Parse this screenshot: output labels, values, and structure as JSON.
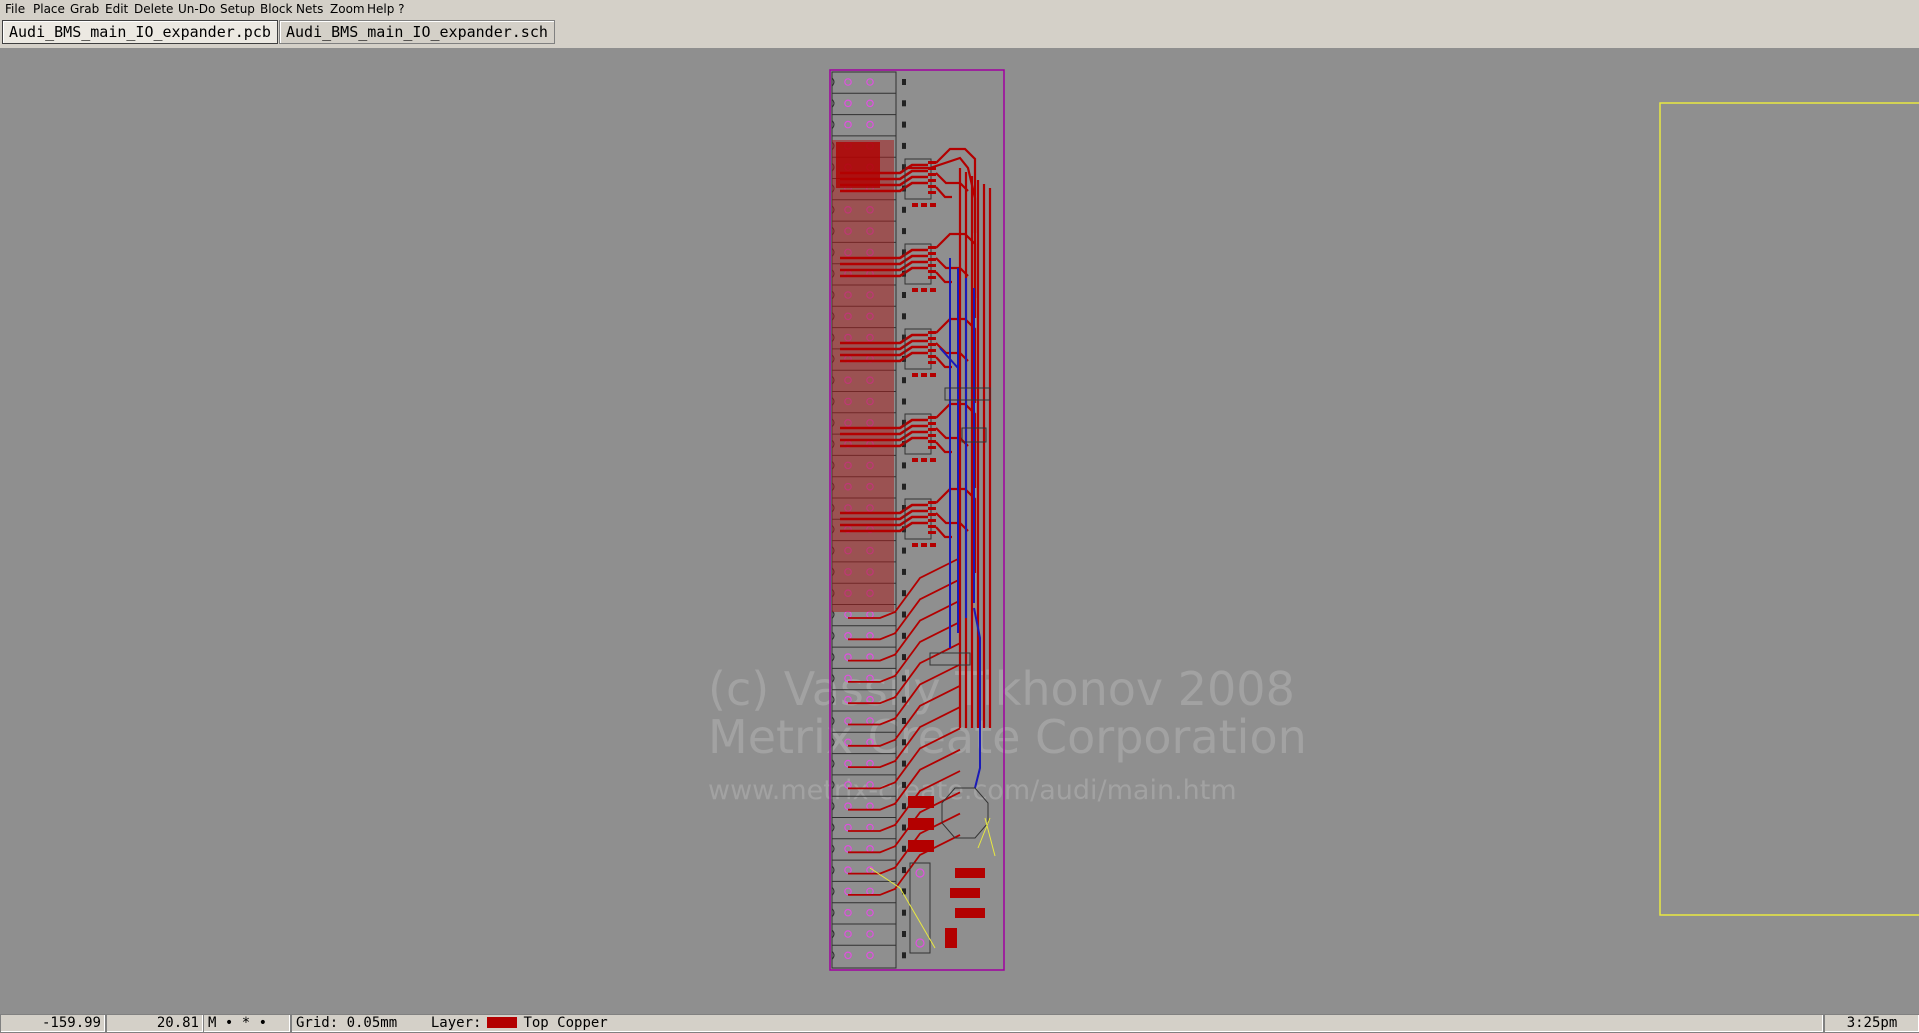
{
  "menu": {
    "items": [
      "File",
      "Place",
      "Grab",
      "Edit",
      "Delete",
      "Un-Do",
      "Setup",
      "Block",
      "Nets",
      "Zoom",
      "Help ?"
    ]
  },
  "tabs": [
    {
      "label": "Audi_BMS_main_IO_expander.pcb",
      "active": true
    },
    {
      "label": "Audi_BMS_main_IO_expander.sch",
      "active": false
    }
  ],
  "watermark": {
    "line1": "(c) Vassily Tikhonov 2008",
    "line2": "Metrix Create Corporation",
    "line3": "www.metrix-create.com/audi/main.htm"
  },
  "status": {
    "x_coord": "-159.99",
    "y_coord": "20.81",
    "mode_indicators": "M • * •",
    "grid": "Grid: 0.05mm",
    "layer_label": "Layer:",
    "layer_name": "Top Copper",
    "clock": "3:25pm"
  },
  "colors": {
    "top_copper": "#b30000",
    "bottom_copper": "#1a1ab8",
    "board_outline": "#a000a0",
    "ratsnest": "#e8e840",
    "pads": "#e050e0",
    "background": "#8f8f8f"
  }
}
